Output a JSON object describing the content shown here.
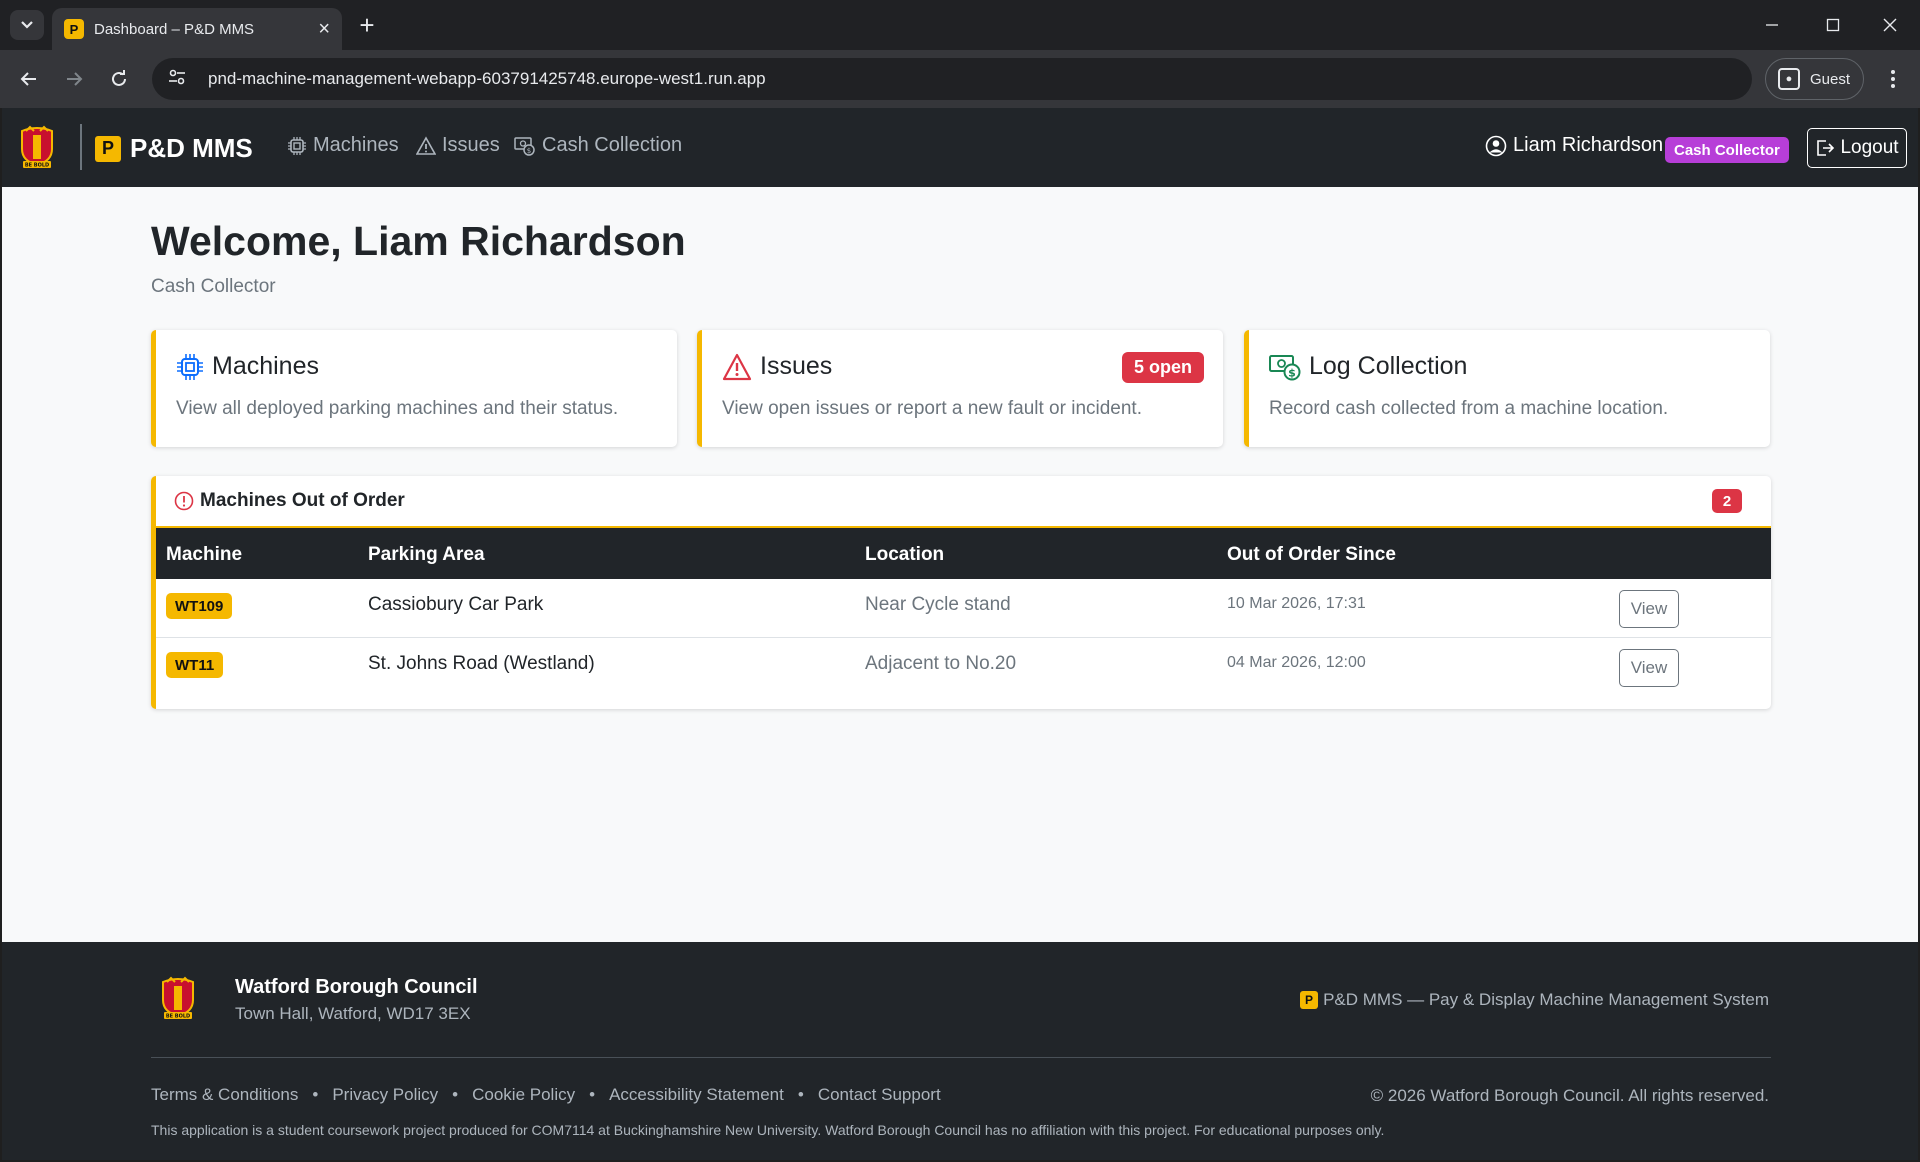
{
  "browser": {
    "tab_title": "Dashboard – P&D MMS",
    "tab_favicon": "P",
    "url": "pnd-machine-management-webapp-603791425748.europe-west1.run.app",
    "profile_label": "Guest"
  },
  "nav": {
    "brand": "P&D MMS",
    "brand_icon": "P",
    "crest_text": "BE BOLD",
    "links": [
      "Machines",
      "Issues",
      "Cash Collection"
    ],
    "user_name": "Liam Richardson",
    "role": "Cash Collector",
    "logout": "Logout"
  },
  "welcome": {
    "title": "Welcome, Liam Richardson",
    "subtitle": "Cash Collector"
  },
  "cards": [
    {
      "title": "Machines",
      "text": "View all deployed parking machines and their status.",
      "icon": "chip-icon"
    },
    {
      "title": "Issues",
      "text": "View open issues or report a new fault or incident.",
      "badge": "5 open",
      "icon": "warning-icon"
    },
    {
      "title": "Log Collection",
      "text": "Record cash collected from a machine location.",
      "icon": "cash-icon"
    }
  ],
  "out_of_order": {
    "title": "Machines Out of Order",
    "count": "2",
    "columns": [
      "Machine",
      "Parking Area",
      "Location",
      "Out of Order Since"
    ],
    "rows": [
      {
        "machine": "WT109",
        "area": "Cassiobury Car Park",
        "location": "Near Cycle stand",
        "since": "10 Mar 2026, 17:31",
        "action": "View"
      },
      {
        "machine": "WT11",
        "area": "St. Johns Road (Westland)",
        "location": "Adjacent to No.20",
        "since": "04 Mar 2026, 12:00",
        "action": "View"
      }
    ]
  },
  "footer": {
    "org": "Watford Borough Council",
    "address": "Town Hall, Watford, WD17 3EX",
    "app_name": "P&D MMS — Pay & Display Machine Management System",
    "links": [
      "Terms & Conditions",
      "Privacy Policy",
      "Cookie Policy",
      "Accessibility Statement",
      "Contact Support"
    ],
    "copyright": "© 2026 Watford Borough Council. All rights reserved.",
    "disclaimer": "This application is a student coursework project produced for COM7114 at Buckinghamshire New University. Watford Borough Council has no affiliation with this project. For educational purposes only."
  },
  "colors": {
    "accent": "#f5b800",
    "danger": "#dc3545",
    "role": "#b73ed8",
    "dark": "#212529"
  }
}
